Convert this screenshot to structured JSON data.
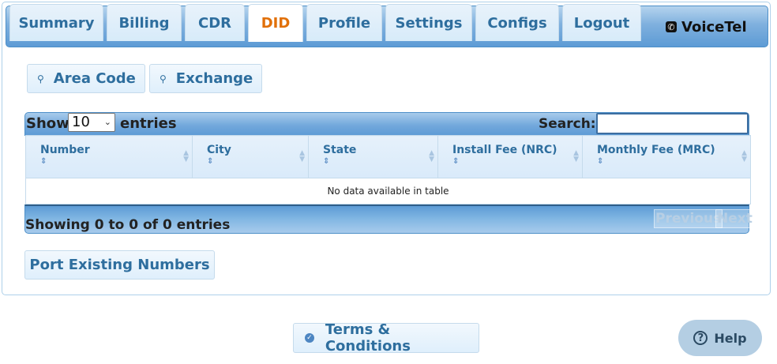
{
  "tabs": [
    {
      "label": "Summary",
      "active": false
    },
    {
      "label": "Billing",
      "active": false
    },
    {
      "label": "CDR",
      "active": false
    },
    {
      "label": "DID",
      "active": true
    },
    {
      "label": "Profile",
      "active": false
    },
    {
      "label": "Settings",
      "active": false
    },
    {
      "label": "Configs",
      "active": false
    },
    {
      "label": "Logout",
      "active": false
    }
  ],
  "brand": {
    "name": "VoiceTel",
    "icon": "phone-icon"
  },
  "search_buttons": [
    {
      "label": "Area Code",
      "icon": "search-icon"
    },
    {
      "label": "Exchange",
      "icon": "search-icon"
    }
  ],
  "table": {
    "length_label_before": "Show",
    "length_value": "10",
    "length_label_after": "entries",
    "search_label": "Search:",
    "search_value": "",
    "columns": [
      "Number",
      "City",
      "State",
      "Install Fee (NRC)",
      "Monthly Fee (MRC)"
    ],
    "empty_message": "No data available in table",
    "info": "Showing 0 to 0 of 0 entries",
    "previous_label": "Previous",
    "next_label": "Next"
  },
  "port_button": {
    "label": "Port Existing Numbers"
  },
  "terms_button": {
    "label": "Terms & Conditions",
    "icon": "check-circle-icon"
  },
  "help_button": {
    "label": "Help",
    "icon": "question-circle-icon"
  },
  "colors": {
    "accent": "#2e6e9e",
    "active_tab": "#e17009",
    "header_blue": "#5d9bd5",
    "button_bg": "#dfeffc"
  }
}
